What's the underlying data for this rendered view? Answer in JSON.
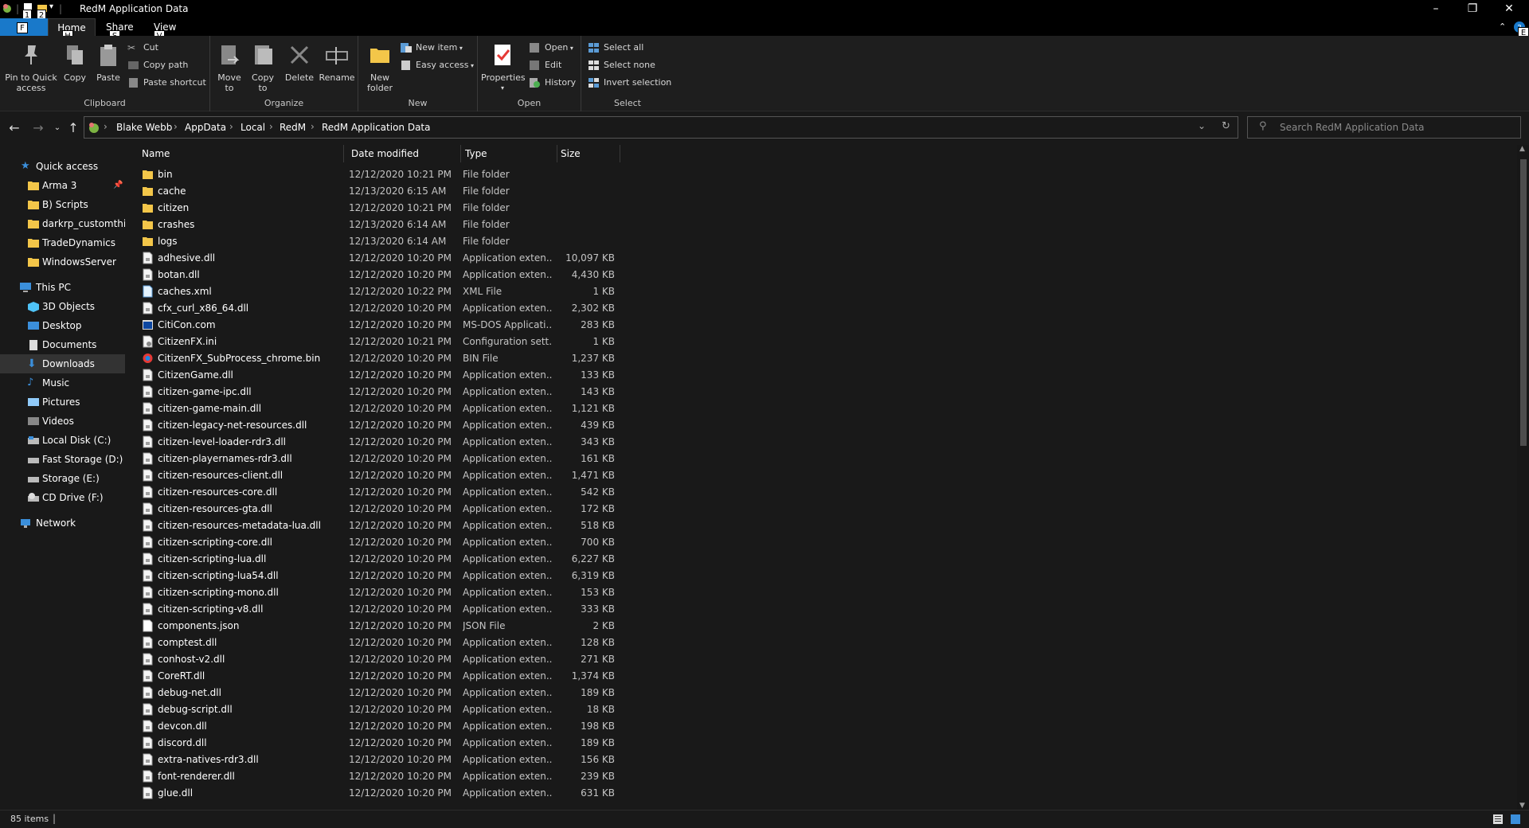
{
  "window": {
    "title": "RedM Application Data",
    "qat_badges": [
      "1",
      "2"
    ]
  },
  "tabs": {
    "file": "F",
    "home": "Home",
    "home_key": "H",
    "share": "Share",
    "share_key": "S",
    "view": "View",
    "view_key": "V",
    "help_key": "E"
  },
  "ribbon": {
    "clipboard": {
      "label": "Clipboard",
      "pin": "Pin to Quick access",
      "copy": "Copy",
      "paste": "Paste",
      "cut": "Cut",
      "copy_path": "Copy path",
      "paste_shortcut": "Paste shortcut"
    },
    "organize": {
      "label": "Organize",
      "move_to": "Move to",
      "copy_to": "Copy to",
      "delete": "Delete",
      "rename": "Rename"
    },
    "new": {
      "label": "New",
      "new_folder": "New folder",
      "new_item": "New item",
      "easy_access": "Easy access"
    },
    "open": {
      "label": "Open",
      "properties": "Properties",
      "open": "Open",
      "edit": "Edit",
      "history": "History"
    },
    "select": {
      "label": "Select",
      "select_all": "Select all",
      "select_none": "Select none",
      "invert": "Invert selection"
    }
  },
  "address": {
    "crumbs": [
      "Blake Webb",
      "AppData",
      "Local",
      "RedM",
      "RedM Application Data"
    ]
  },
  "search": {
    "placeholder": "Search RedM Application Data"
  },
  "nav": {
    "quick_access": "Quick access",
    "pinned": [
      "Arma 3",
      "B) Scripts",
      "darkrp_customthings",
      "TradeDynamics",
      "WindowsServer"
    ],
    "this_pc": "This PC",
    "pc_items": [
      "3D Objects",
      "Desktop",
      "Documents",
      "Downloads",
      "Music",
      "Pictures",
      "Videos",
      "Local Disk (C:)",
      "Fast Storage (D:)",
      "Storage (E:)",
      "CD Drive (F:)"
    ],
    "network": "Network"
  },
  "columns": {
    "name": "Name",
    "date": "Date modified",
    "type": "Type",
    "size": "Size"
  },
  "files": [
    [
      "bin",
      "12/12/2020 10:21 PM",
      "File folder",
      "",
      "folder"
    ],
    [
      "cache",
      "12/13/2020 6:15 AM",
      "File folder",
      "",
      "folder"
    ],
    [
      "citizen",
      "12/12/2020 10:21 PM",
      "File folder",
      "",
      "folder"
    ],
    [
      "crashes",
      "12/13/2020 6:14 AM",
      "File folder",
      "",
      "folder"
    ],
    [
      "logs",
      "12/13/2020 6:14 AM",
      "File folder",
      "",
      "folder"
    ],
    [
      "adhesive.dll",
      "12/12/2020 10:20 PM",
      "Application exten...",
      "10,097 KB",
      "dll"
    ],
    [
      "botan.dll",
      "12/12/2020 10:20 PM",
      "Application exten...",
      "4,430 KB",
      "dll"
    ],
    [
      "caches.xml",
      "12/12/2020 10:22 PM",
      "XML File",
      "1 KB",
      "xml"
    ],
    [
      "cfx_curl_x86_64.dll",
      "12/12/2020 10:20 PM",
      "Application exten...",
      "2,302 KB",
      "dll"
    ],
    [
      "CitiCon.com",
      "12/12/2020 10:20 PM",
      "MS-DOS Applicati...",
      "283 KB",
      "com"
    ],
    [
      "CitizenFX.ini",
      "12/12/2020 10:21 PM",
      "Configuration sett...",
      "1 KB",
      "ini"
    ],
    [
      "CitizenFX_SubProcess_chrome.bin",
      "12/12/2020 10:20 PM",
      "BIN File",
      "1,237 KB",
      "bin"
    ],
    [
      "CitizenGame.dll",
      "12/12/2020 10:20 PM",
      "Application exten...",
      "133 KB",
      "dll"
    ],
    [
      "citizen-game-ipc.dll",
      "12/12/2020 10:20 PM",
      "Application exten...",
      "143 KB",
      "dll"
    ],
    [
      "citizen-game-main.dll",
      "12/12/2020 10:20 PM",
      "Application exten...",
      "1,121 KB",
      "dll"
    ],
    [
      "citizen-legacy-net-resources.dll",
      "12/12/2020 10:20 PM",
      "Application exten...",
      "439 KB",
      "dll"
    ],
    [
      "citizen-level-loader-rdr3.dll",
      "12/12/2020 10:20 PM",
      "Application exten...",
      "343 KB",
      "dll"
    ],
    [
      "citizen-playernames-rdr3.dll",
      "12/12/2020 10:20 PM",
      "Application exten...",
      "161 KB",
      "dll"
    ],
    [
      "citizen-resources-client.dll",
      "12/12/2020 10:20 PM",
      "Application exten...",
      "1,471 KB",
      "dll"
    ],
    [
      "citizen-resources-core.dll",
      "12/12/2020 10:20 PM",
      "Application exten...",
      "542 KB",
      "dll"
    ],
    [
      "citizen-resources-gta.dll",
      "12/12/2020 10:20 PM",
      "Application exten...",
      "172 KB",
      "dll"
    ],
    [
      "citizen-resources-metadata-lua.dll",
      "12/12/2020 10:20 PM",
      "Application exten...",
      "518 KB",
      "dll"
    ],
    [
      "citizen-scripting-core.dll",
      "12/12/2020 10:20 PM",
      "Application exten...",
      "700 KB",
      "dll"
    ],
    [
      "citizen-scripting-lua.dll",
      "12/12/2020 10:20 PM",
      "Application exten...",
      "6,227 KB",
      "dll"
    ],
    [
      "citizen-scripting-lua54.dll",
      "12/12/2020 10:20 PM",
      "Application exten...",
      "6,319 KB",
      "dll"
    ],
    [
      "citizen-scripting-mono.dll",
      "12/12/2020 10:20 PM",
      "Application exten...",
      "153 KB",
      "dll"
    ],
    [
      "citizen-scripting-v8.dll",
      "12/12/2020 10:20 PM",
      "Application exten...",
      "333 KB",
      "dll"
    ],
    [
      "components.json",
      "12/12/2020 10:20 PM",
      "JSON File",
      "2 KB",
      "json"
    ],
    [
      "comptest.dll",
      "12/12/2020 10:20 PM",
      "Application exten...",
      "128 KB",
      "dll"
    ],
    [
      "conhost-v2.dll",
      "12/12/2020 10:20 PM",
      "Application exten...",
      "271 KB",
      "dll"
    ],
    [
      "CoreRT.dll",
      "12/12/2020 10:20 PM",
      "Application exten...",
      "1,374 KB",
      "dll"
    ],
    [
      "debug-net.dll",
      "12/12/2020 10:20 PM",
      "Application exten...",
      "189 KB",
      "dll"
    ],
    [
      "debug-script.dll",
      "12/12/2020 10:20 PM",
      "Application exten...",
      "18 KB",
      "dll"
    ],
    [
      "devcon.dll",
      "12/12/2020 10:20 PM",
      "Application exten...",
      "198 KB",
      "dll"
    ],
    [
      "discord.dll",
      "12/12/2020 10:20 PM",
      "Application exten...",
      "189 KB",
      "dll"
    ],
    [
      "extra-natives-rdr3.dll",
      "12/12/2020 10:20 PM",
      "Application exten...",
      "156 KB",
      "dll"
    ],
    [
      "font-renderer.dll",
      "12/12/2020 10:20 PM",
      "Application exten...",
      "239 KB",
      "dll"
    ],
    [
      "glue.dll",
      "12/12/2020 10:20 PM",
      "Application exten...",
      "631 KB",
      "dll"
    ]
  ],
  "status": {
    "items": "85 items"
  },
  "colors": {
    "accent": "#1979ca",
    "folder": "#f3c649",
    "background": "#191919"
  }
}
